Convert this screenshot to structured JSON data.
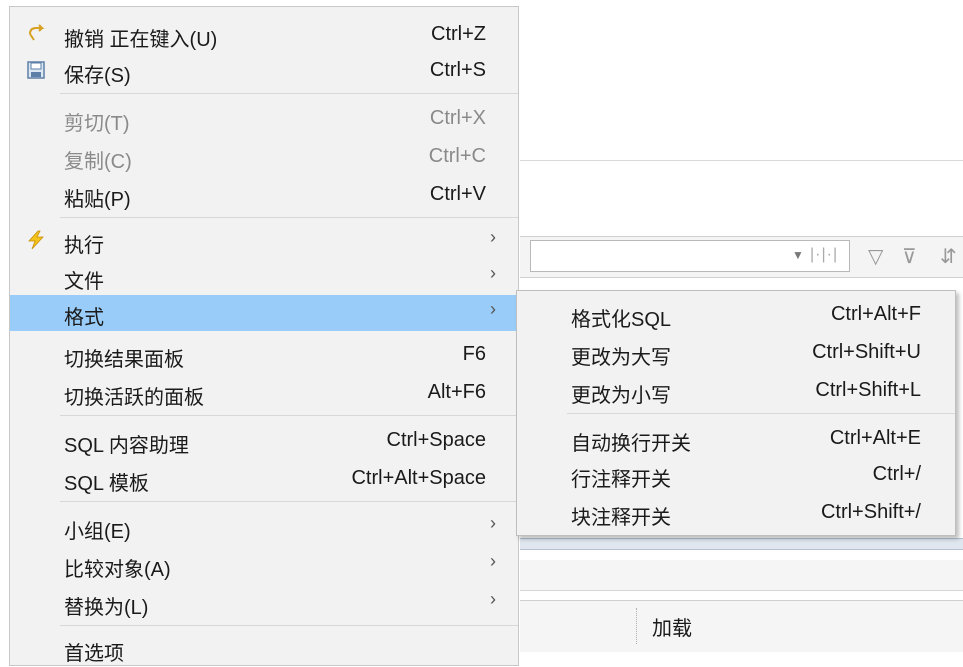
{
  "menu": {
    "undo": {
      "label": "撤销 正在键入(U)",
      "shortcut": "Ctrl+Z",
      "icon": "undo-icon"
    },
    "save": {
      "label": "保存(S)",
      "shortcut": "Ctrl+S",
      "icon": "save-icon"
    },
    "cut": {
      "label": "剪切(T)",
      "shortcut": "Ctrl+X"
    },
    "copy": {
      "label": "复制(C)",
      "shortcut": "Ctrl+C"
    },
    "paste": {
      "label": "粘贴(P)",
      "shortcut": "Ctrl+V"
    },
    "execute": {
      "label": "执行",
      "icon": "lightning-icon"
    },
    "file": {
      "label": "文件"
    },
    "format": {
      "label": "格式"
    },
    "toggle_result": {
      "label": "切换结果面板",
      "shortcut": "F6"
    },
    "toggle_active": {
      "label": "切换活跃的面板",
      "shortcut": "Alt+F6"
    },
    "sql_assist": {
      "label": "SQL 内容助理",
      "shortcut": "Ctrl+Space"
    },
    "sql_template": {
      "label": "SQL 模板",
      "shortcut": "Ctrl+Alt+Space"
    },
    "group": {
      "label": "小组(E)"
    },
    "compare": {
      "label": "比较对象(A)"
    },
    "replace": {
      "label": "替换为(L)"
    },
    "prefs": {
      "label": "首选项"
    },
    "arrow": "›"
  },
  "submenu": {
    "format_sql": {
      "label": "格式化SQL",
      "shortcut": "Ctrl+Alt+F"
    },
    "upper": {
      "label": "更改为大写",
      "shortcut": "Ctrl+Shift+U"
    },
    "lower": {
      "label": "更改为小写",
      "shortcut": "Ctrl+Shift+L"
    },
    "wrap": {
      "label": "自动换行开关",
      "shortcut": "Ctrl+Alt+E"
    },
    "line_comment": {
      "label": "行注释开关",
      "shortcut": "Ctrl+/"
    },
    "block_comment": {
      "label": "块注释开关",
      "shortcut": "Ctrl+Shift+/"
    }
  },
  "background": {
    "load_label": "加载"
  },
  "colors": {
    "menu_bg": "#f2f2f2",
    "highlight": "#99ccf8",
    "disabled_text": "#8a8a8a"
  }
}
